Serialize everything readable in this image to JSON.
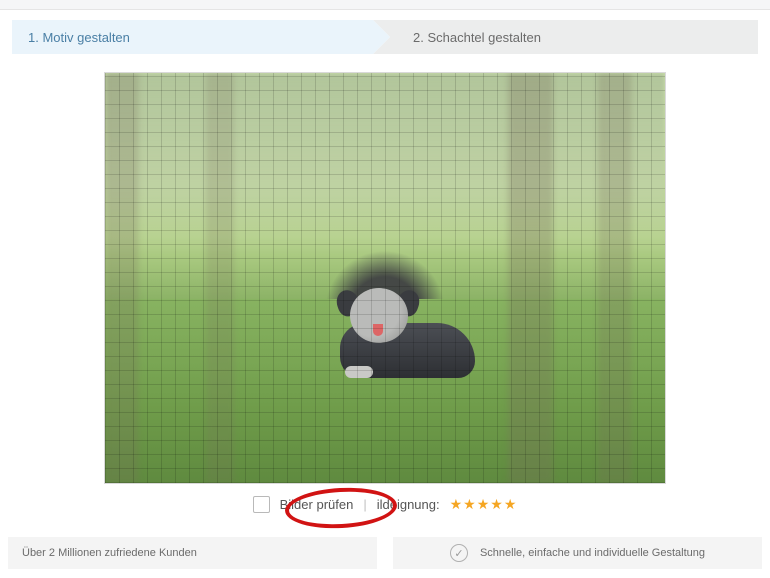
{
  "stepper": {
    "step1": "1. Motiv gestalten",
    "step2": "2. Schachtel gestalten"
  },
  "toolbar": {
    "check_images_label": "Bilder prüfen",
    "divider": "|",
    "suitability_label": "ildeignung:",
    "rating_stars": "★★★★★"
  },
  "footer": {
    "left_text": "Über 2 Millionen zufriedene Kunden",
    "right_text": "Schnelle, einfache und individuelle Gestaltung",
    "check_glyph": "✓"
  },
  "icons": {
    "checkbox": "checkbox-icon",
    "check_badge": "check-circle-icon"
  }
}
